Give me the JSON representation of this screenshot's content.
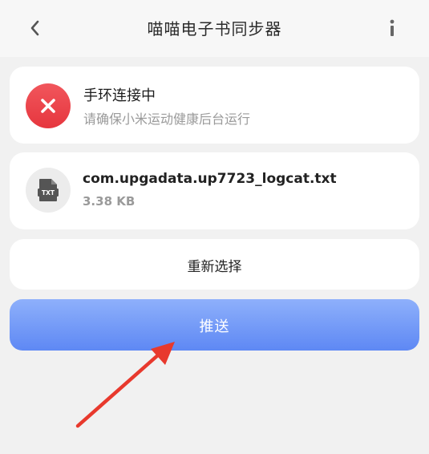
{
  "header": {
    "title": "喵喵电子书同步器",
    "back_icon": "chevron-left-icon",
    "info_icon": "info-icon"
  },
  "status": {
    "icon": "close-circle-icon",
    "title": "手环连接中",
    "subtitle": "请确保小米运动健康后台运行",
    "color": "#e8393f"
  },
  "file": {
    "icon": "txt-file-icon",
    "icon_text": "TXT",
    "name": "com.upgadata.up7723_logcat.txt",
    "size": "3.38 KB"
  },
  "actions": {
    "reselect_label": "重新选择",
    "push_label": "推送",
    "push_color": "#6b93f6"
  },
  "annotation": {
    "arrow_color": "#e8392d"
  }
}
